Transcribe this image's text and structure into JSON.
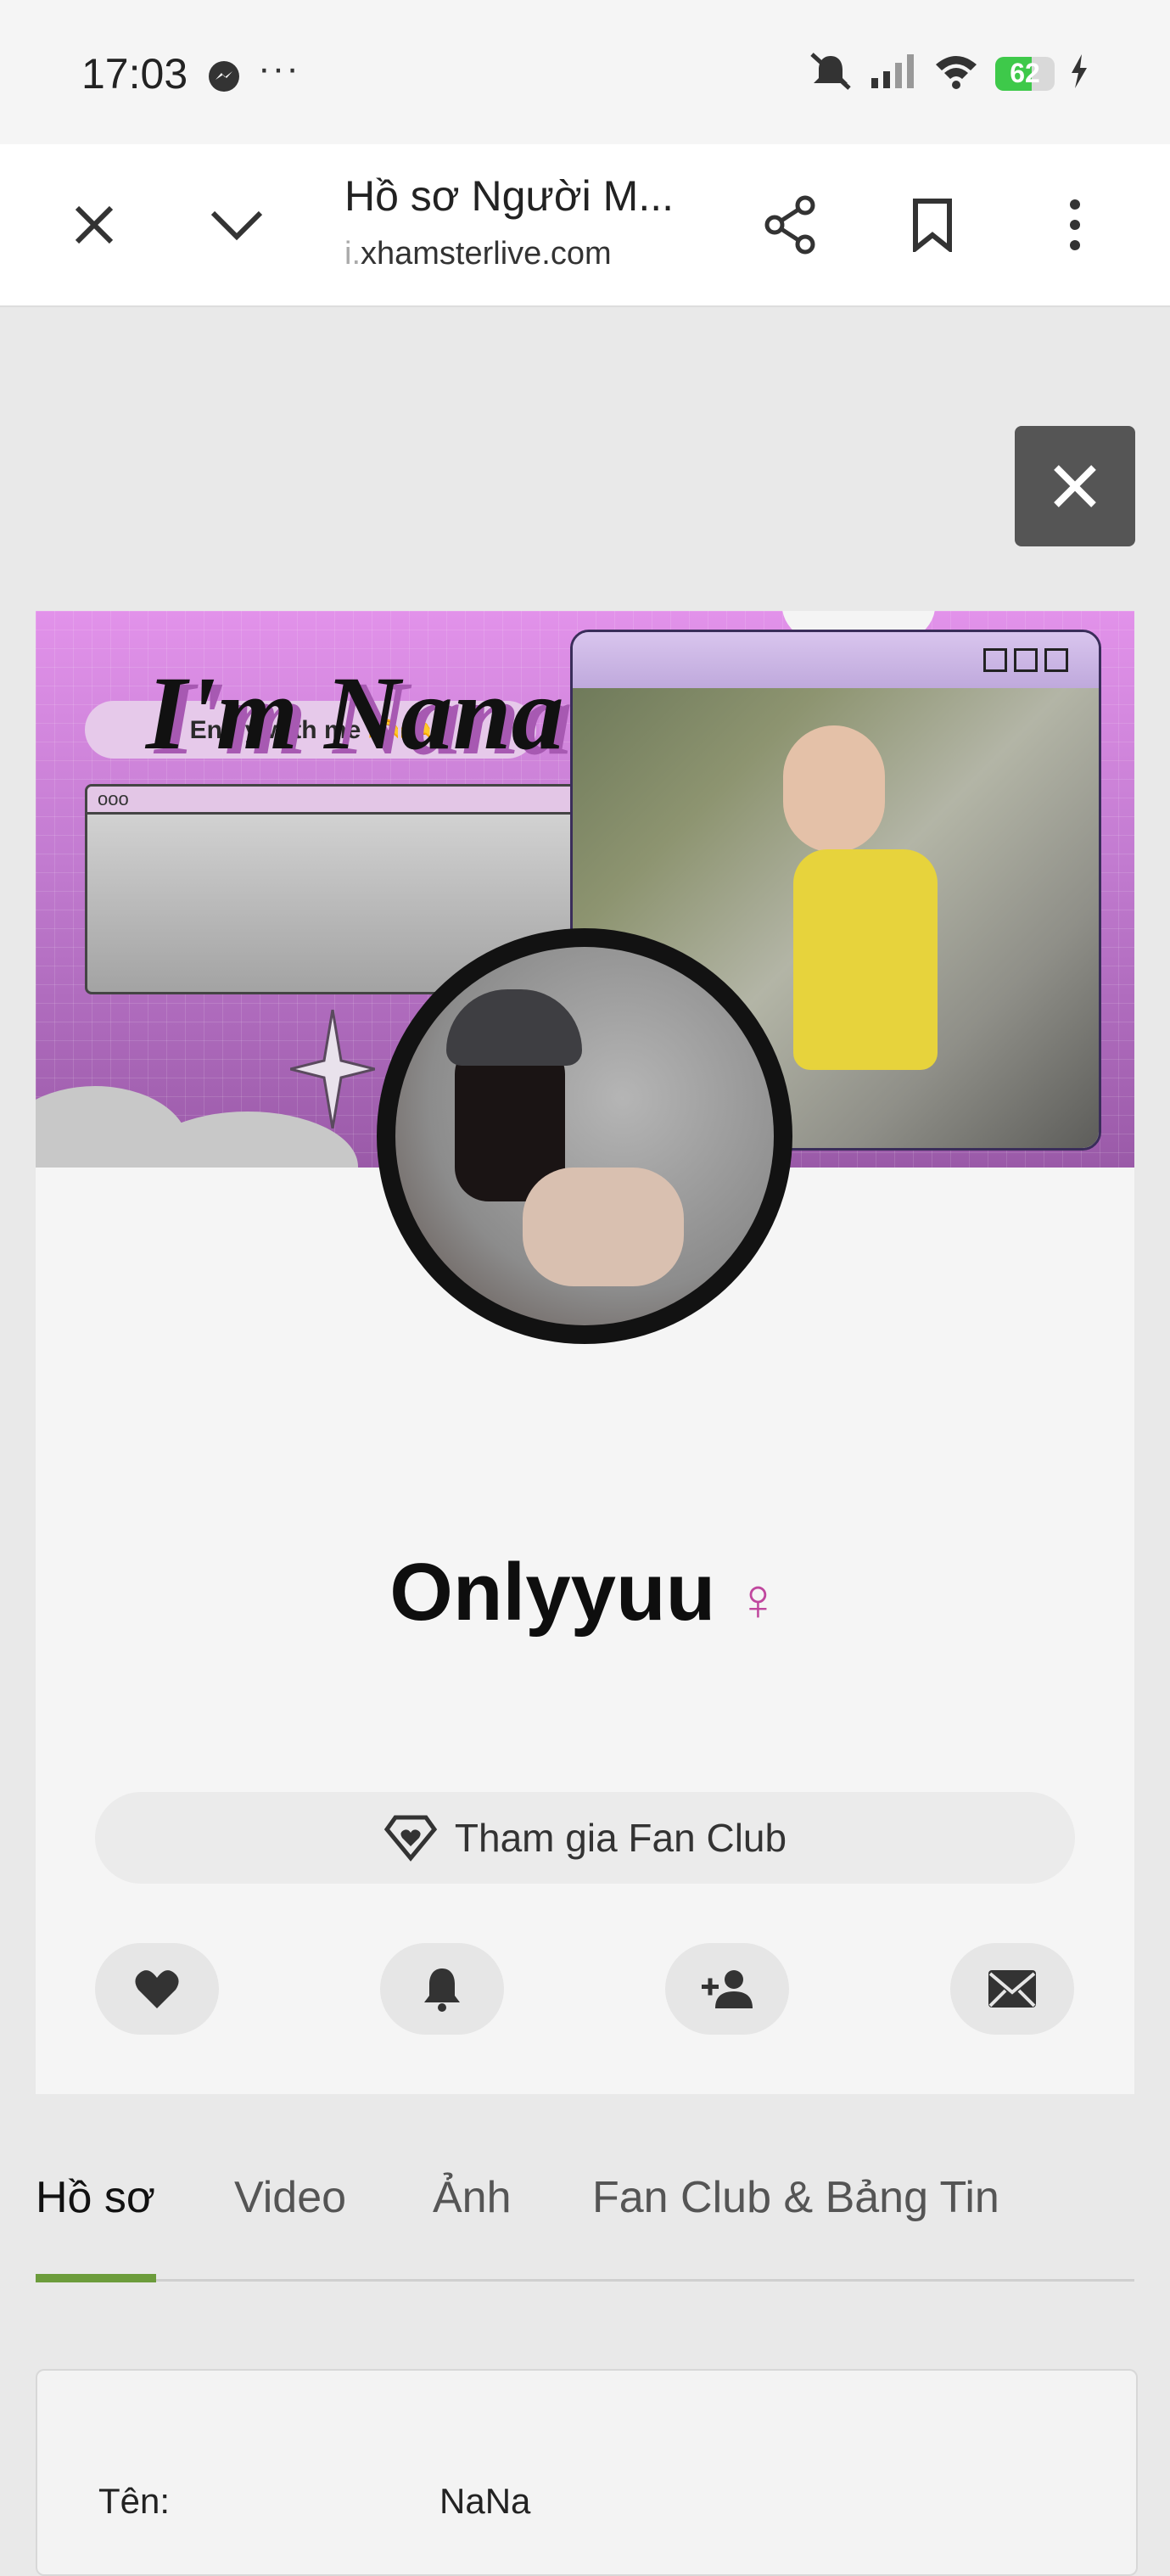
{
  "status_bar": {
    "time": "17:03",
    "more": "···",
    "battery_level": 62,
    "battery_text": "62",
    "icons": [
      "messenger-icon",
      "mute-icon",
      "signal-icon",
      "wifi-icon",
      "battery-icon",
      "charging-icon"
    ]
  },
  "toolbar": {
    "title": "Hồ sơ Người M...",
    "url_prefix": "i.",
    "url_domain": "xhamsterlive.com",
    "icons": [
      "close-icon",
      "chevron-down-icon",
      "share-icon",
      "bookmark-icon",
      "more-vert-icon"
    ]
  },
  "banner": {
    "pill_text": "Enjoy with me 🫶🫶",
    "window_dots": "ooo",
    "window_plus": "+",
    "headline": "I'm Nana"
  },
  "profile": {
    "username": "Onlyyuu",
    "gender_symbol": "♀",
    "fanclub_label": "Tham gia Fan Club",
    "actions": [
      "heart-icon",
      "bell-icon",
      "add-friend-icon",
      "message-icon"
    ]
  },
  "tabs": [
    {
      "label": "Hồ sơ",
      "active": true
    },
    {
      "label": "Video",
      "active": false
    },
    {
      "label": "Ảnh",
      "active": false
    },
    {
      "label": "Fan Club & Bảng Tin",
      "active": false
    }
  ],
  "info": {
    "name_label": "Tên:",
    "name_value": "NaNa"
  },
  "colors": {
    "accent_green": "#6c9c3c",
    "gender_pink": "#c0479e",
    "battery_green": "#3ec94a"
  }
}
